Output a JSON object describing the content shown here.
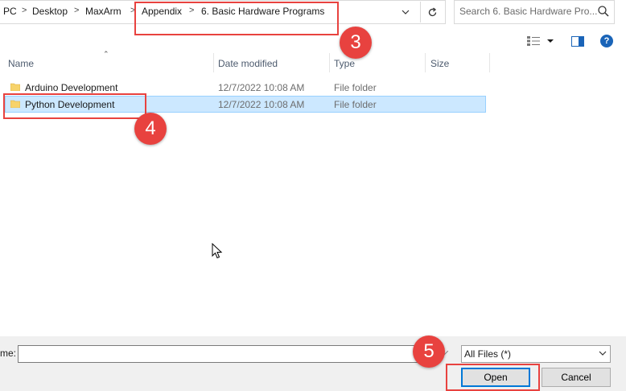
{
  "address": {
    "crumbs": [
      "PC",
      "Desktop",
      "MaxArm",
      "Appendix",
      "6. Basic Hardware Programs"
    ],
    "separator": ">",
    "dropdown_icon": "chevron-down-icon",
    "refresh_icon": "refresh-icon"
  },
  "search": {
    "placeholder": "Search 6. Basic Hardware Pro..."
  },
  "toolbar": {
    "view_icon": "view-details-icon",
    "pane_icon": "preview-pane-icon",
    "help_label": "?"
  },
  "columns": [
    "Name",
    "Date modified",
    "Type",
    "Size"
  ],
  "rows": [
    {
      "name": "Arduino Development",
      "date": "12/7/2022 10:08 AM",
      "type": "File folder",
      "size": ""
    },
    {
      "name": "Python Development",
      "date": "12/7/2022 10:08 AM",
      "type": "File folder",
      "size": ""
    }
  ],
  "annotations": {
    "step3": "3",
    "step4": "4",
    "step5": "5",
    "color": "#e8423f"
  },
  "bottom": {
    "filename_label": "me:",
    "filename_value": "",
    "filetype": "All Files  (*)",
    "open_label": "Open",
    "cancel_label": "Cancel"
  },
  "colors": {
    "selection": "#cce8ff",
    "accent": "#0078d7"
  }
}
